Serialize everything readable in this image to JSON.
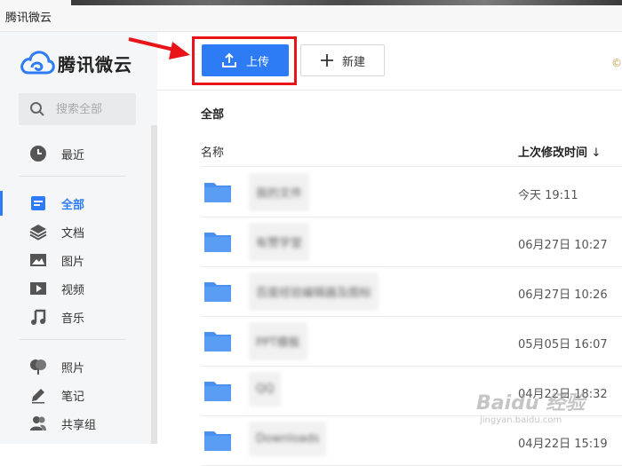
{
  "window": {
    "title": "腾讯微云"
  },
  "logo": {
    "text": "腾讯微云"
  },
  "search": {
    "placeholder": "搜索全部"
  },
  "sidebar": {
    "recent": "最近",
    "items": [
      {
        "label": "全部",
        "icon": "document-icon",
        "active": true
      },
      {
        "label": "文档",
        "icon": "layers-icon"
      },
      {
        "label": "图片",
        "icon": "image-icon"
      },
      {
        "label": "视频",
        "icon": "video-icon"
      },
      {
        "label": "音乐",
        "icon": "music-icon"
      }
    ],
    "extras": [
      {
        "label": "照片",
        "icon": "photo-icon"
      },
      {
        "label": "笔记",
        "icon": "pen-icon"
      },
      {
        "label": "共享组",
        "icon": "group-icon"
      }
    ]
  },
  "toolbar": {
    "upload_label": "上传",
    "new_label": "新建"
  },
  "breadcrumb": "全部",
  "columns": {
    "name": "名称",
    "modified": "上次修改时间"
  },
  "files": [
    {
      "name": "我的文件",
      "time": "今天 19:11"
    },
    {
      "name": "有赞学堂",
      "time": "06月27日 10:27"
    },
    {
      "name": "百度经验编辑器及图标",
      "time": "06月27日 10:26"
    },
    {
      "name": "PPT模板",
      "time": "05月05日 16:07"
    },
    {
      "name": "QQ",
      "time": "04月22日 18:32"
    },
    {
      "name": "Downloads",
      "time": "04月22日 15:19"
    }
  ],
  "colors": {
    "accent": "#2d7cf6",
    "annotation": "#e8141a",
    "folder": "#4a90f0"
  },
  "watermark": {
    "line1": "Baidu 经验",
    "line2": "jingyan.baidu.com"
  }
}
